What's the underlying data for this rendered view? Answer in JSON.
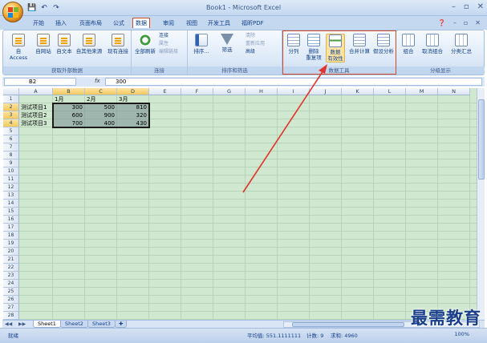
{
  "window": {
    "title": "Book1 - Microsoft Excel",
    "controls": [
      "–",
      "▫",
      "✕"
    ]
  },
  "qat": {
    "save": "💾",
    "undo": "↶",
    "redo": "↷"
  },
  "tabs": [
    {
      "label": "开始"
    },
    {
      "label": "插入"
    },
    {
      "label": "页面布局"
    },
    {
      "label": "公式"
    },
    {
      "label": "数据",
      "active": true
    },
    {
      "label": "审阅"
    },
    {
      "label": "视图"
    },
    {
      "label": "开发工具"
    },
    {
      "label": "福昕PDF"
    }
  ],
  "help_controls": [
    "❓",
    "–",
    "▫",
    "✕"
  ],
  "ribbon": {
    "get_external": {
      "title": "获取外部数据",
      "buttons": [
        "自 Access",
        "自网站",
        "自文本",
        "自其他来源",
        "现有连接"
      ]
    },
    "connections": {
      "title": "连接",
      "refresh_all": "全部刷新",
      "small": [
        "连接",
        "属性",
        "编辑链接"
      ]
    },
    "sort_filter": {
      "title": "排序和筛选",
      "sort": "排序...",
      "filter": "筛选",
      "small": [
        "清除",
        "重新应用",
        "高级"
      ]
    },
    "data_tools": {
      "title": "数据工具",
      "split": "分列",
      "remove_dup_1": "删除",
      "remove_dup_2": "重复项",
      "validation_1": "数据",
      "validation_2": "有效性",
      "consolidate": "合并计算",
      "whatif": "假设分析"
    },
    "outline": {
      "title": "分级显示",
      "group": "组合",
      "ungroup": "取消组合",
      "subtotal": "分类汇总"
    }
  },
  "formula_bar": {
    "name_box": "B2",
    "fx": "fx",
    "value": "300"
  },
  "columns": [
    "A",
    "B",
    "C",
    "D",
    "E",
    "F",
    "G",
    "H",
    "I",
    "J",
    "K",
    "L",
    "M",
    "N"
  ],
  "rows": [
    "1",
    "2",
    "3",
    "4",
    "5",
    "6",
    "7",
    "8",
    "9",
    "10",
    "11",
    "12",
    "13",
    "14",
    "15",
    "16",
    "17",
    "18",
    "19",
    "20",
    "21",
    "22",
    "23",
    "24",
    "25",
    "26",
    "27",
    "28"
  ],
  "cells": {
    "B1": "1月",
    "C1": "2月",
    "D1": "3月",
    "A2": "测试项目1",
    "A3": "测试项目2",
    "A4": "测试项目3",
    "B2": "300",
    "C2": "500",
    "D2": "810",
    "B3": "600",
    "C3": "900",
    "D3": "320",
    "B4": "700",
    "C4": "400",
    "D4": "430"
  },
  "sheets": [
    {
      "label": "Sheet1",
      "active": true
    },
    {
      "label": "Sheet2"
    },
    {
      "label": "Sheet3"
    }
  ],
  "status": {
    "ready": "就绪",
    "average": "平均值: 551.1111111",
    "count": "计数: 9",
    "sum": "求和: 4960",
    "zoom": "100%"
  },
  "watermark": "最需教育",
  "colors": {
    "accent": "#d34a2b",
    "grid_bg": "#cfe8cf",
    "ribbon_text": "#15428b"
  }
}
